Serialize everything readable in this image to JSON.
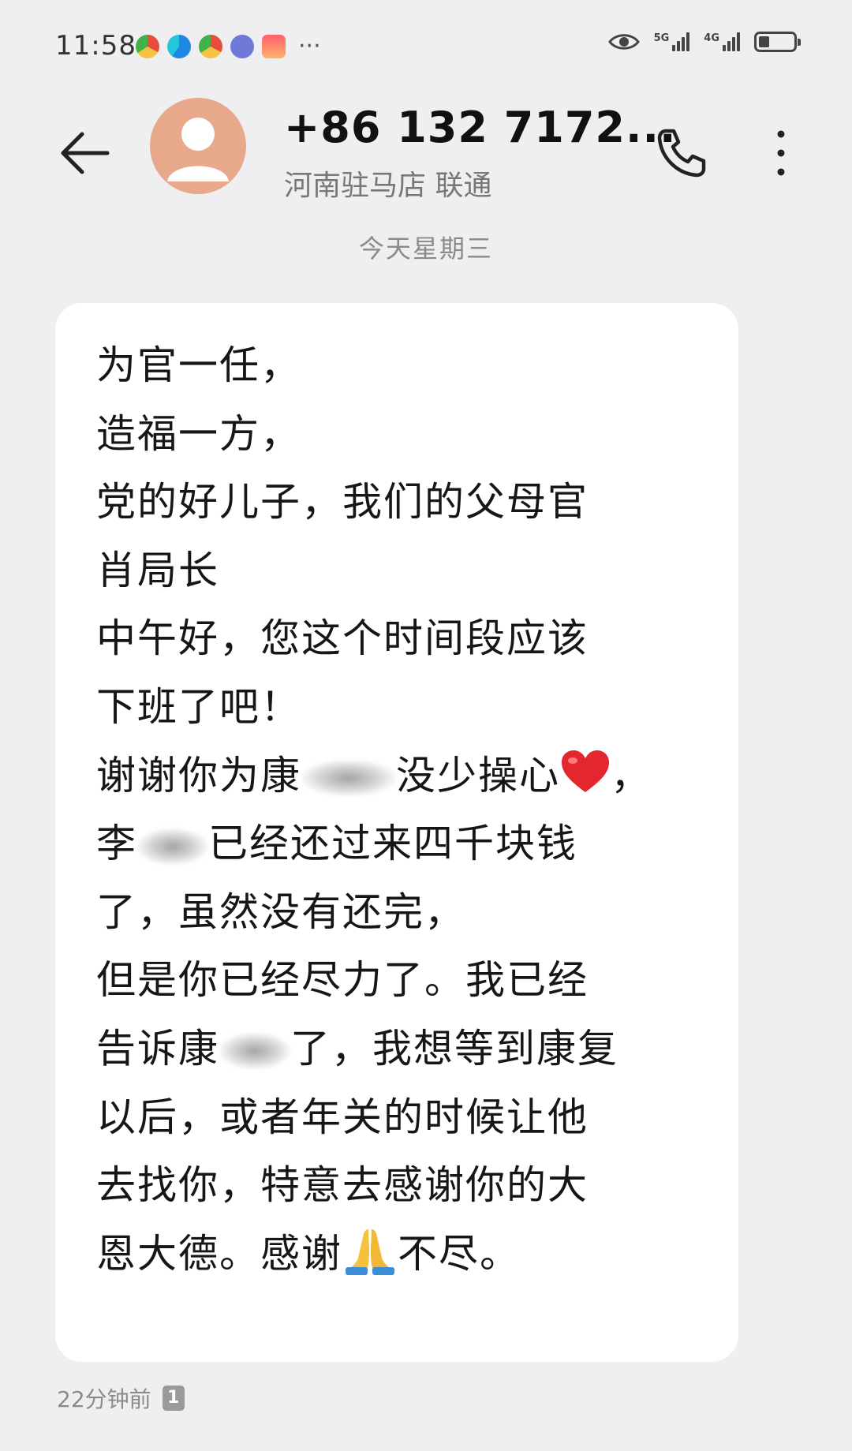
{
  "status_bar": {
    "time": "11:58",
    "network_1": "5G",
    "network_2": "4G",
    "more": "···",
    "battery_level": 0.3
  },
  "header": {
    "contact_number": "+86 132 7172...",
    "contact_location": "河南驻马店 联通"
  },
  "date_separator": "今天星期三",
  "message": {
    "lines": [
      "为官一任，",
      "造福一方，",
      "党的好儿子，我们的父母官",
      "肖局长",
      "中午好，您这个时间段应该",
      "下班了吧！",
      "谢谢你为康",
      "没少操心",
      "，",
      "李",
      "已经还过来四千块钱",
      "了，虽然没有还完，",
      "但是你已经尽力了。我已经",
      "告诉康",
      "了，我想等到康复",
      "以后，或者年关的时候让他",
      "去找你，特意去感谢你的大",
      "恩大德。感谢",
      "不尽。"
    ]
  },
  "footer": {
    "time_ago": "22分钟前",
    "sim_slot": "1"
  },
  "colors": {
    "background": "#efeff1",
    "bubble": "#ffffff",
    "avatar": "#e7a88b",
    "secondary_text": "#8a8a8a"
  }
}
